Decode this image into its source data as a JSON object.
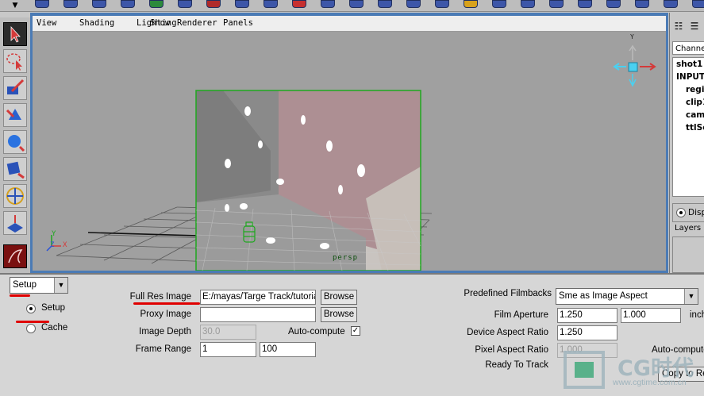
{
  "viewport": {
    "menu": [
      "View",
      "Shading",
      "Lighting",
      "Show",
      "Renderer",
      "Panels"
    ],
    "camera_label": "persp",
    "axis_labels": {
      "y": "Y",
      "z": "Z",
      "x": "X"
    },
    "view_cube_label": "Y"
  },
  "channel_box": {
    "header": "Channe",
    "items": [
      {
        "label": "shot1",
        "indent": false
      },
      {
        "label": "INPUT",
        "indent": false
      },
      {
        "label": "regis",
        "indent": true
      },
      {
        "label": "clip1",
        "indent": true
      },
      {
        "label": "cam",
        "indent": true
      },
      {
        "label": "ttlSc",
        "indent": true
      }
    ],
    "display_option": "Disp",
    "layers_label": "Layers"
  },
  "panel": {
    "mode_select": "Setup",
    "mode_radios": [
      {
        "label": "Setup",
        "selected": true
      },
      {
        "label": "Cache",
        "selected": false
      }
    ],
    "full_res_image": {
      "label": "Full Res Image",
      "value": "E:/mayas/Targe Track/tutoria",
      "button": "Browse"
    },
    "proxy_image": {
      "label": "Proxy Image",
      "value": "",
      "button": "Browse"
    },
    "image_depth": {
      "label": "Image Depth",
      "value": "30.0"
    },
    "auto_compute": {
      "label": "Auto-compute",
      "checked": true,
      "mark": "✓"
    },
    "frame_range": {
      "label": "Frame Range",
      "start": "1",
      "end": "100"
    },
    "predefined_filmbacks": {
      "label": "Predefined Filmbacks",
      "value": "Sme as Image Aspect"
    },
    "film_aperture": {
      "label": "Film Aperture",
      "width": "1.250",
      "height": "1.000",
      "unit": "inch"
    },
    "device_aspect_ratio": {
      "label": "Device Aspect Ratio",
      "value": "1.250"
    },
    "pixel_aspect_ratio": {
      "label": "Pixel Aspect Ratio",
      "value": "1.000",
      "auto_compute": "Auto-compute"
    },
    "ready_to_track": {
      "label": "Ready To Track",
      "copy_button": "Copy to Re"
    }
  },
  "watermark": {
    "text": "CG时代",
    "url": "www.cgtime.com.cn"
  },
  "colors": {
    "viewport_border": "#4b7bb5",
    "viewport_bg": "#a0a0a0",
    "highlight_line": "#e00000",
    "camera_green": "#1fa81f"
  }
}
